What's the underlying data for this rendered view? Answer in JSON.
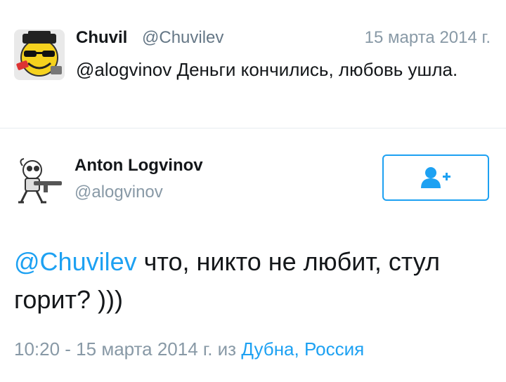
{
  "parent_tweet": {
    "name": "Chuvil",
    "handle": "@Chuvilev",
    "date": "15 марта 2014 г.",
    "text": "@alogvinov Деньги кончились, любовь ушла."
  },
  "main_tweet": {
    "name": "Anton Logvinov",
    "handle": "@alogvinov",
    "follow_icon": "follow-user-plus-icon",
    "text_mention": "@Chuvilev",
    "text_body": " что, никто не любит, стул горит? )))",
    "meta_time": "10:20 - 15 марта 2014 г. из ",
    "meta_location": "Дубна, Россия"
  },
  "colors": {
    "accent": "#1da1f2",
    "text": "#14171a",
    "muted": "#8899a6",
    "divider": "#e6ecf0"
  }
}
